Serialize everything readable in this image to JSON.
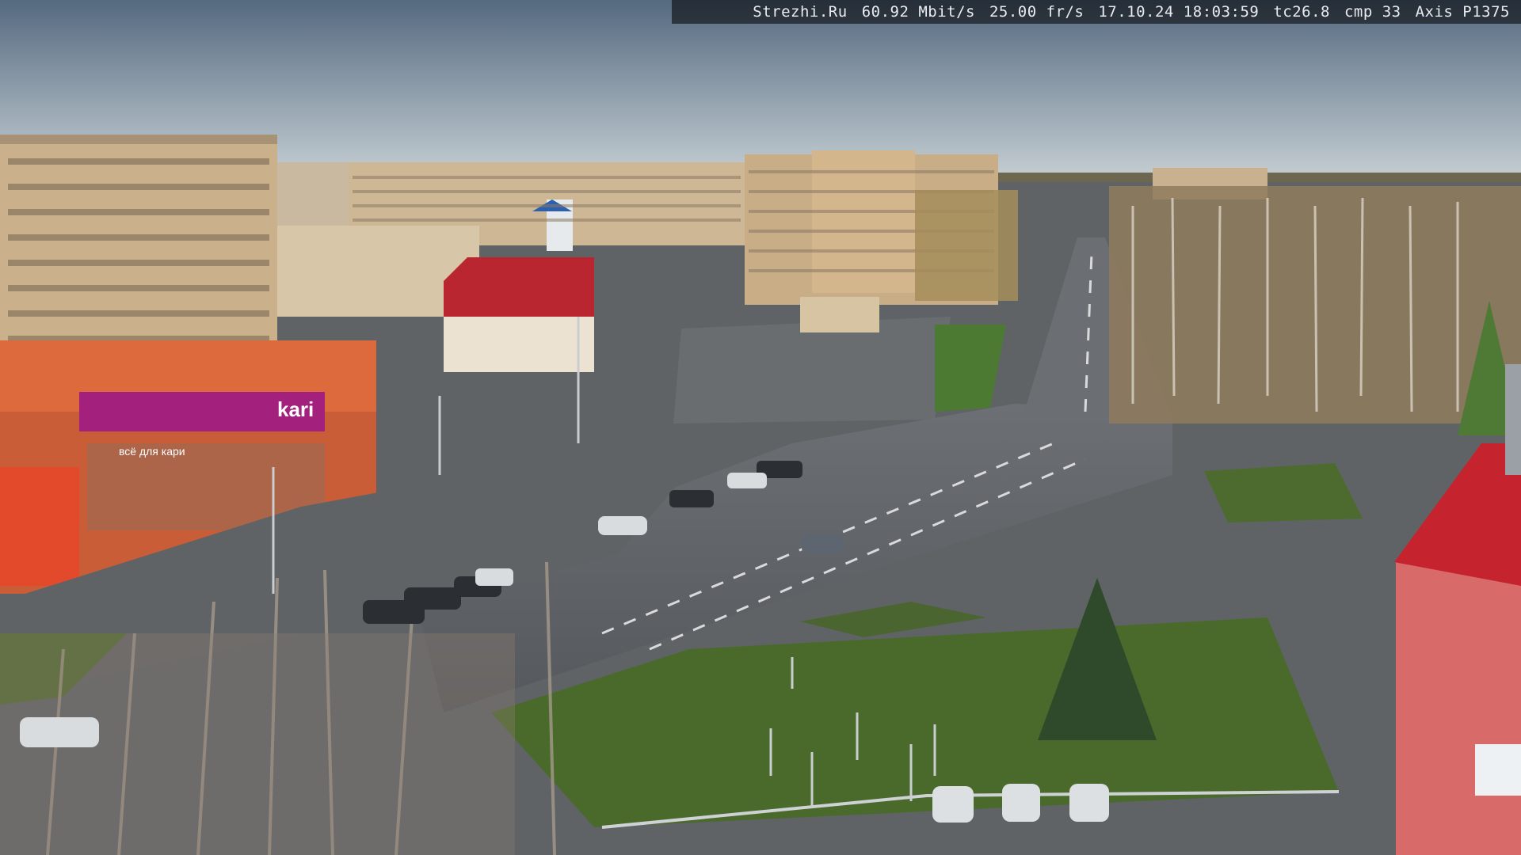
{
  "overlay": {
    "site": "Strezhi.Ru",
    "bitrate": "60.92 Mbit/s",
    "framerate": "25.00 fr/s",
    "datetime": "17.10.24 18:03:59",
    "tc": "tc26.8",
    "cmp": "cmp 33",
    "camera": "Axis P1375"
  },
  "signs": {
    "store_brand": "kari",
    "store_sub": "всё для кари"
  },
  "colors": {
    "sky_top": "#5a6f8a",
    "sky_horizon": "#c9d3d8",
    "asphalt": "#5e6265",
    "grass": "#4c6a2e",
    "building_tan": "#c9b08e",
    "building_orange": "#e06a3a",
    "store_magenta": "#a0217a",
    "roof_red": "#c0272d"
  }
}
